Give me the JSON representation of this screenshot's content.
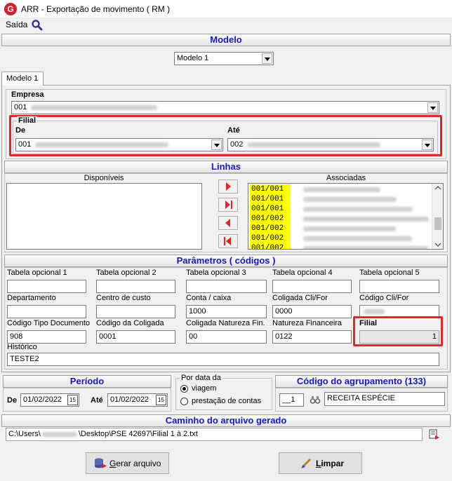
{
  "window": {
    "title": "ARR - Exportação de movimento ( RM )",
    "icon_letter": "G"
  },
  "menu": {
    "saida": "Saída"
  },
  "modelo": {
    "header": "Modelo",
    "selected": "Modelo 1"
  },
  "tab": {
    "label": "Modelo 1"
  },
  "empresa": {
    "label": "Empresa",
    "value": "001"
  },
  "filial": {
    "group_label": "Filial",
    "de_label": "De",
    "ate_label": "Até",
    "de_value": "001",
    "ate_value": "002"
  },
  "linhas": {
    "header": "Linhas",
    "disponiveis_label": "Disponíveis",
    "associadas_label": "Associadas",
    "associadas": [
      "001/001",
      "001/001",
      "001/001",
      "001/002",
      "001/002",
      "001/002",
      "001/002"
    ]
  },
  "parametros": {
    "header": "Parâmetros ( códigos )",
    "fields": [
      {
        "label": "Tabela opcional 1",
        "value": ""
      },
      {
        "label": "Tabela opcional 2",
        "value": ""
      },
      {
        "label": "Tabela opcional 3",
        "value": ""
      },
      {
        "label": "Tabela opcional 4",
        "value": ""
      },
      {
        "label": "Tabela opcional 5",
        "value": ""
      },
      {
        "label": "Departamento",
        "value": ""
      },
      {
        "label": "Centro de custo",
        "value": ""
      },
      {
        "label": "Conta / caixa",
        "value": "1000"
      },
      {
        "label": "Coligada Cli/For",
        "value": "0000"
      },
      {
        "label": "Código Cli/For",
        "value": ""
      },
      {
        "label": "Código Tipo Documento",
        "value": "908"
      },
      {
        "label": "Código da Coligada",
        "value": "0001"
      },
      {
        "label": "Coligada Natureza Fin.",
        "value": "00"
      },
      {
        "label": "Natureza Financeira",
        "value": "0122"
      },
      {
        "label": "Filial",
        "value": "1"
      }
    ],
    "historico_label": "Histórico",
    "historico_value": "TESTE2"
  },
  "periodo": {
    "header": "Período",
    "de_label": "De",
    "ate_label": "Até",
    "de_value": "01/02/2022",
    "ate_value": "01/02/2022",
    "cal_text": "15"
  },
  "por_data": {
    "label": "Por data da",
    "opt1": "viagem",
    "opt2": "prestação de contas",
    "selected": "viagem"
  },
  "agrupamento": {
    "header": "Código do agrupamento (133)",
    "code": "__1",
    "desc": "RECEITA ESPÉCIE"
  },
  "caminho": {
    "header": "Caminho do arquivo gerado",
    "path_prefix": "C:\\Users\\",
    "path_suffix": "\\Desktop\\PSE 42697\\Filial 1 à 2.txt"
  },
  "buttons": {
    "gerar_u": "G",
    "gerar_rest": "erar arquivo",
    "limpar_u": "L",
    "limpar_rest": "impar"
  }
}
